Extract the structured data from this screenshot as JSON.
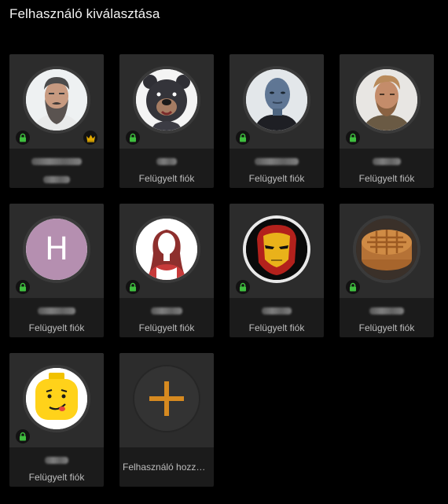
{
  "header": {
    "title": "Felhasználó kiválasztása"
  },
  "profiles": [
    {
      "avatar": "bearded-man-photo",
      "supervised_label": "",
      "owner": true
    },
    {
      "avatar": "cartoon-bear-photo",
      "supervised_label": "Felügyelt fiók"
    },
    {
      "avatar": "blue-alien-photo",
      "supervised_label": "Felügyelt fiók"
    },
    {
      "avatar": "rugged-man-photo",
      "supervised_label": "Felügyelt fiók"
    },
    {
      "avatar": "letter-avatar",
      "letter": "H",
      "supervised_label": "Felügyelt fiók"
    },
    {
      "avatar": "woman-silhouette",
      "supervised_label": "Felügyelt fiók"
    },
    {
      "avatar": "iron-helmet",
      "supervised_label": "Felügyelt fiók"
    },
    {
      "avatar": "pie-photo",
      "supervised_label": "Felügyelt fiók"
    },
    {
      "avatar": "toy-head",
      "supervised_label": "Felügyelt fiók"
    }
  ],
  "add_user": {
    "label": "Felhasználó hozzáadása"
  },
  "colors": {
    "background": "#000000",
    "tile_top": "#2c2c2c",
    "tile_bottom": "#1b1b1b",
    "lock_green": "#3fbf3f",
    "crown_gold": "#e0a800",
    "plus_orange": "#d68a20",
    "letter_avatar_bg": "#b58fb0"
  }
}
